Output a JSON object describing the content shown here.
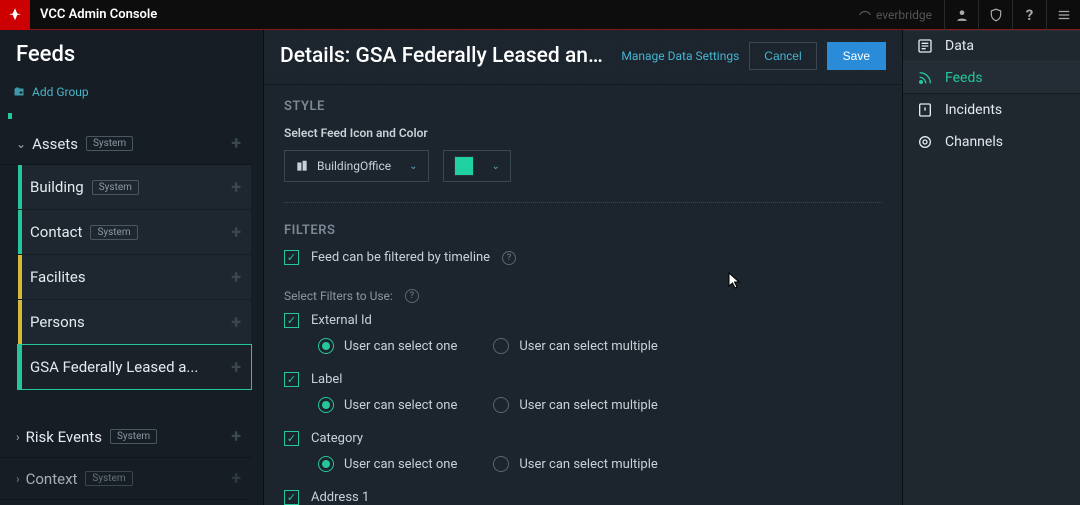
{
  "topbar": {
    "title": "VCC Admin Console",
    "brand_right": "everbridge"
  },
  "sidebar": {
    "title": "Feeds",
    "add_group_label": "Add Group",
    "groups": [
      {
        "name": "Assets",
        "tag": "System",
        "items": [
          {
            "label": "Building",
            "tag": "System",
            "color": "green"
          },
          {
            "label": "Contact",
            "tag": "System",
            "color": "green"
          },
          {
            "label": "Facilites",
            "tag": "",
            "color": "yellow"
          },
          {
            "label": "Persons",
            "tag": "",
            "color": "yellow"
          },
          {
            "label": "GSA Federally Leased a...",
            "tag": "",
            "color": "green",
            "selected": true
          }
        ]
      },
      {
        "name": "Risk Events",
        "tag": "System",
        "items": []
      },
      {
        "name": "Context",
        "tag": "System",
        "items": []
      }
    ]
  },
  "main": {
    "title": "Details: GSA Federally Leased and Owned B...",
    "manage_link": "Manage Data Settings",
    "cancel_label": "Cancel",
    "save_label": "Save",
    "style": {
      "heading": "STYLE",
      "sublabel": "Select Feed Icon and Color",
      "icon_label": "BuildingOffice",
      "color": "#1fd1a0"
    },
    "filters": {
      "heading": "FILTERS",
      "timeline_label": "Feed can be filtered by timeline",
      "subheading": "Select Filters to Use:",
      "radio_one_label": "User can select one",
      "radio_multi_label": "User can select multiple",
      "items": [
        {
          "name": "External Id",
          "checked": true,
          "mode": "one"
        },
        {
          "name": "Label",
          "checked": true,
          "mode": "one"
        },
        {
          "name": "Category",
          "checked": true,
          "mode": "one"
        },
        {
          "name": "Address 1",
          "checked": true,
          "mode": "one"
        }
      ]
    }
  },
  "rail": {
    "items": [
      {
        "label": "Data"
      },
      {
        "label": "Feeds",
        "active": true
      },
      {
        "label": "Incidents"
      },
      {
        "label": "Channels"
      }
    ]
  }
}
